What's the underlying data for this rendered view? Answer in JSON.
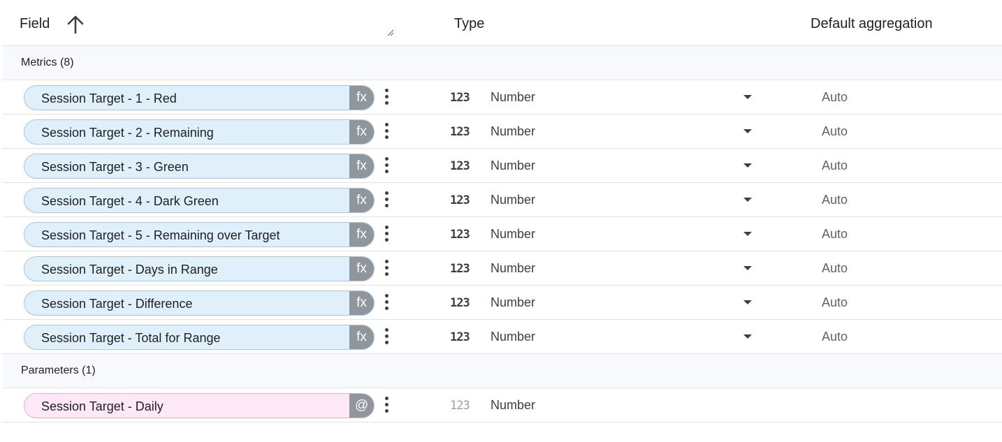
{
  "header": {
    "field_label": "Field",
    "type_label": "Type",
    "aggregation_label": "Default aggregation"
  },
  "sections": {
    "metrics": "Metrics (8)",
    "parameters": "Parameters (1)"
  },
  "metrics": [
    {
      "name": "Session Target - 1 - Red",
      "tag": "fx",
      "type_icon": "123",
      "type": "Number",
      "aggregation": "Auto"
    },
    {
      "name": "Session Target - 2 - Remaining",
      "tag": "fx",
      "type_icon": "123",
      "type": "Number",
      "aggregation": "Auto"
    },
    {
      "name": "Session Target - 3 - Green",
      "tag": "fx",
      "type_icon": "123",
      "type": "Number",
      "aggregation": "Auto"
    },
    {
      "name": "Session Target - 4 - Dark Green",
      "tag": "fx",
      "type_icon": "123",
      "type": "Number",
      "aggregation": "Auto"
    },
    {
      "name": "Session Target - 5 - Remaining over Target",
      "tag": "fx",
      "type_icon": "123",
      "type": "Number",
      "aggregation": "Auto"
    },
    {
      "name": "Session Target - Days in Range",
      "tag": "fx",
      "type_icon": "123",
      "type": "Number",
      "aggregation": "Auto"
    },
    {
      "name": "Session Target - Difference",
      "tag": "fx",
      "type_icon": "123",
      "type": "Number",
      "aggregation": "Auto"
    },
    {
      "name": "Session Target - Total for Range",
      "tag": "fx",
      "type_icon": "123",
      "type": "Number",
      "aggregation": "Auto"
    }
  ],
  "parameters": [
    {
      "name": "Session Target - Daily",
      "tag": "@",
      "type_icon": "123",
      "type": "Number"
    }
  ],
  "colors": {
    "metric_chip_bg": "#dff0fb",
    "parameter_chip_bg": "#fde8f8",
    "chip_tag_bg": "#8f969c",
    "section_bg": "#f8f9fc"
  },
  "icons": {
    "sort": "arrow-up-icon",
    "row_menu": "more-vert-icon",
    "dropdown": "caret-down-icon"
  }
}
